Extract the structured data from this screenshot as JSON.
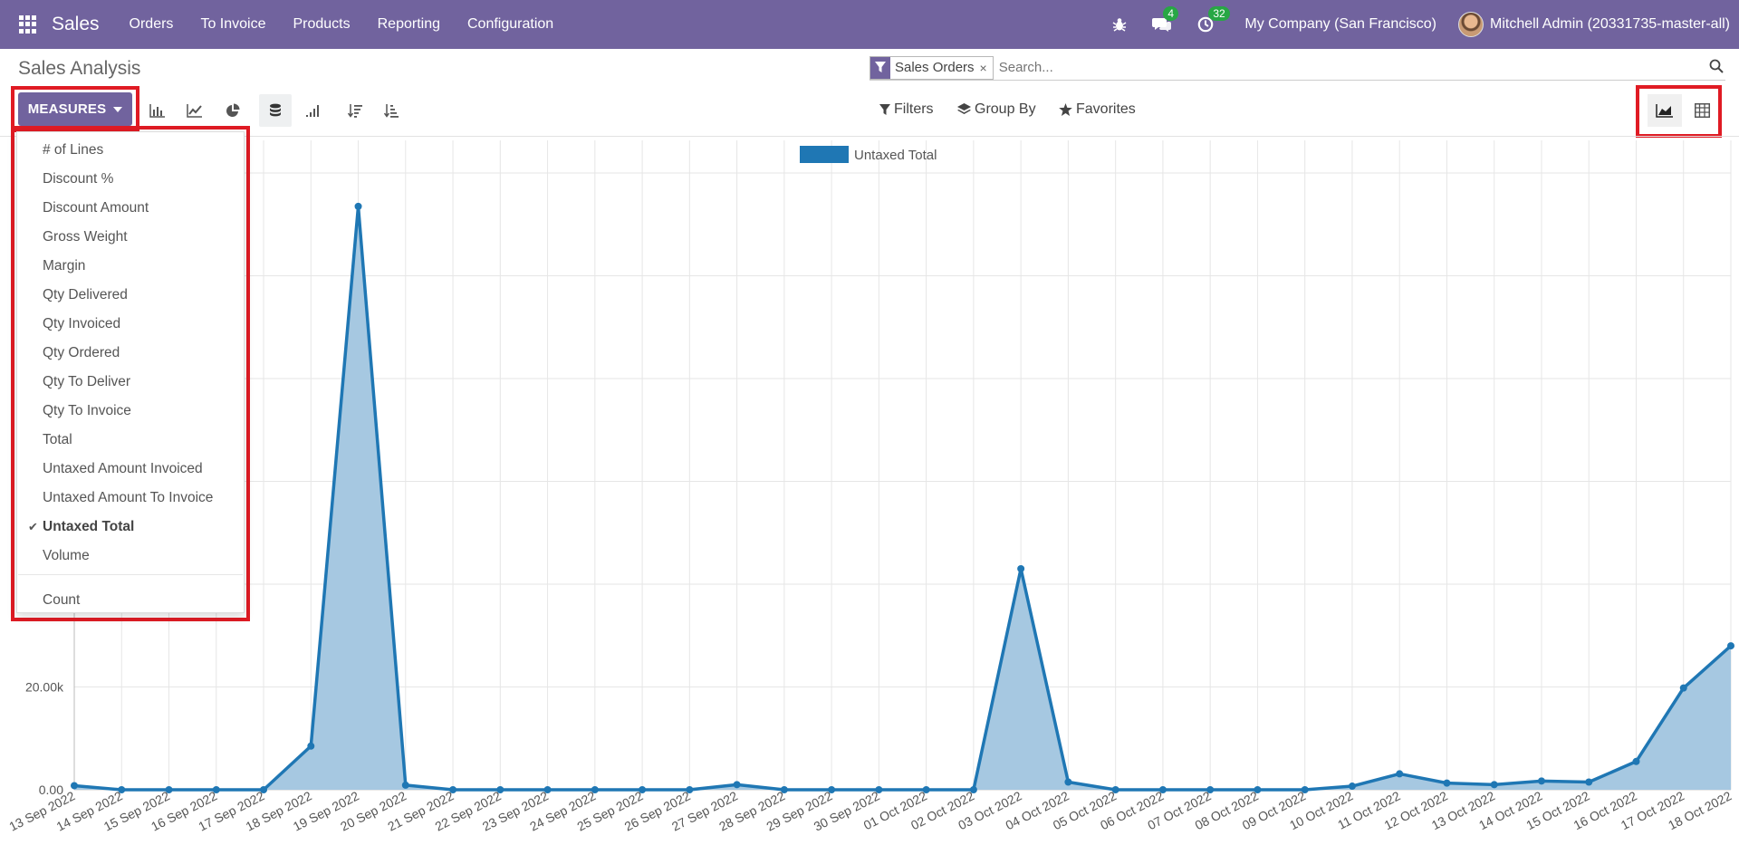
{
  "navbar": {
    "brand": "Sales",
    "menu": [
      "Orders",
      "To Invoice",
      "Products",
      "Reporting",
      "Configuration"
    ],
    "messages_count": "4",
    "activities_count": "32",
    "company": "My Company (San Francisco)",
    "user": "Mitchell Admin (20331735-master-all)"
  },
  "control_panel": {
    "title": "Sales Analysis",
    "facet_label": "Sales Orders",
    "facet_close": "×",
    "search_placeholder": "Search...",
    "measures_label": "MEASURES",
    "filters_label": "Filters",
    "group_by_label": "Group By",
    "favorites_label": "Favorites"
  },
  "measures_dropdown": {
    "items": [
      "# of Lines",
      "Discount %",
      "Discount Amount",
      "Gross Weight",
      "Margin",
      "Qty Delivered",
      "Qty Invoiced",
      "Qty Ordered",
      "Qty To Deliver",
      "Qty To Invoice",
      "Total",
      "Untaxed Amount Invoiced",
      "Untaxed Amount To Invoice",
      "Untaxed Total",
      "Volume"
    ],
    "selected": "Untaxed Total",
    "check_glyph": "✔",
    "count_label": "Count"
  },
  "colors": {
    "navbar": "#71639e",
    "accent": "#71639e",
    "series_line": "#1f77b4",
    "series_fill": "#a6c8e1",
    "highlight": "#e01b24",
    "badge": "#28a745"
  },
  "chart_data": {
    "type": "area",
    "legend": [
      "Untaxed Total"
    ],
    "legend_position": "top-center",
    "grid": true,
    "x": [
      "13 Sep 2022",
      "14 Sep 2022",
      "15 Sep 2022",
      "16 Sep 2022",
      "17 Sep 2022",
      "18 Sep 2022",
      "19 Sep 2022",
      "20 Sep 2022",
      "21 Sep 2022",
      "22 Sep 2022",
      "23 Sep 2022",
      "24 Sep 2022",
      "25 Sep 2022",
      "26 Sep 2022",
      "27 Sep 2022",
      "28 Sep 2022",
      "29 Sep 2022",
      "30 Sep 2022",
      "01 Oct 2022",
      "02 Oct 2022",
      "03 Oct 2022",
      "04 Oct 2022",
      "05 Oct 2022",
      "06 Oct 2022",
      "07 Oct 2022",
      "08 Oct 2022",
      "09 Oct 2022",
      "10 Oct 2022",
      "11 Oct 2022",
      "12 Oct 2022",
      "13 Oct 2022",
      "14 Oct 2022",
      "15 Oct 2022",
      "16 Oct 2022",
      "17 Oct 2022",
      "18 Oct 2022"
    ],
    "series": [
      {
        "name": "Untaxed Total",
        "values": [
          800,
          0,
          0,
          0,
          0,
          8500,
          113500,
          900,
          0,
          0,
          0,
          0,
          0,
          0,
          1000,
          0,
          0,
          0,
          0,
          0,
          43000,
          1500,
          0,
          0,
          0,
          0,
          0,
          700,
          3100,
          1300,
          1000,
          1700,
          1500,
          5500,
          19800,
          28000
        ]
      }
    ],
    "yticks": [
      "0.00",
      "20.00k"
    ],
    "ylim": [
      0,
      120000
    ]
  }
}
